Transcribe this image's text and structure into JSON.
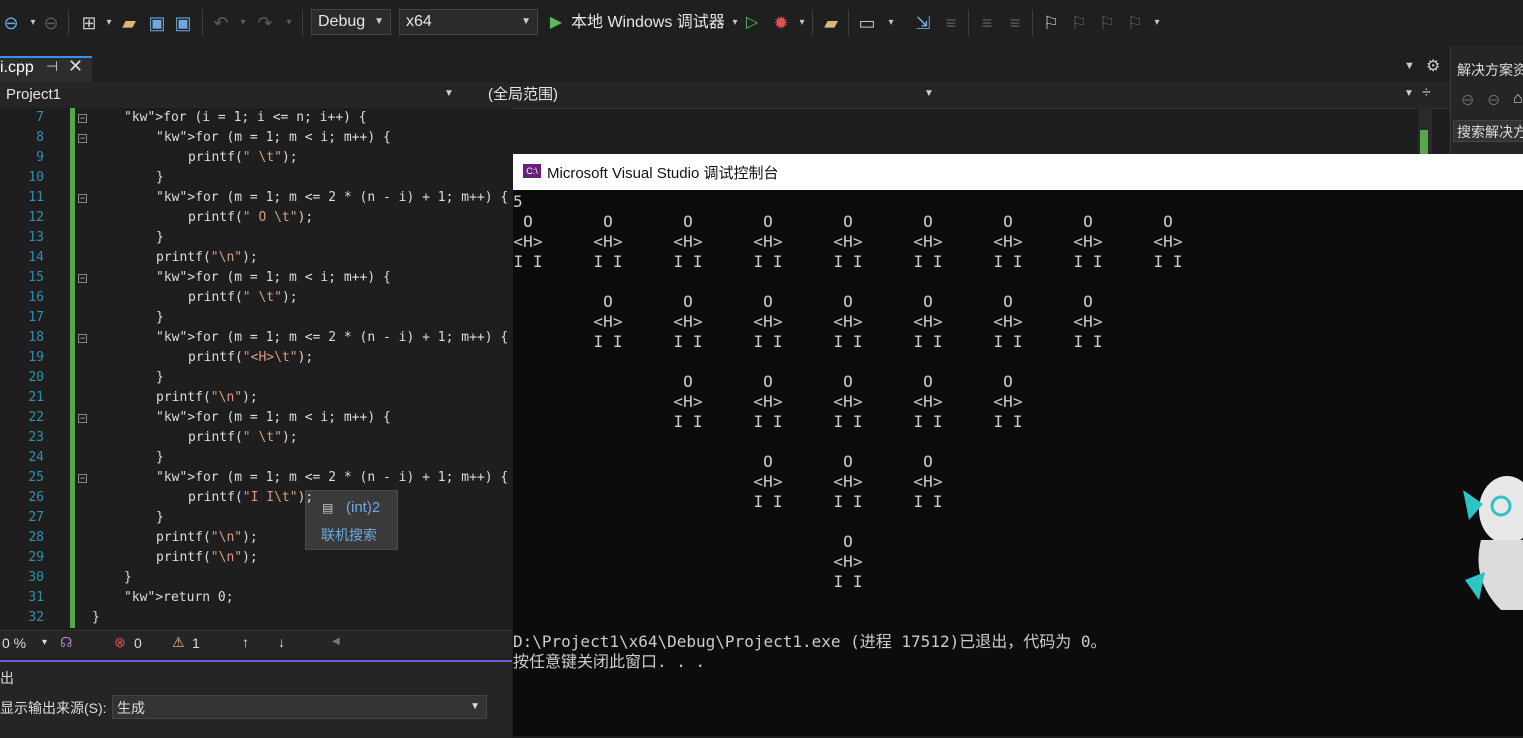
{
  "toolbar": {
    "config": "Debug",
    "platform": "x64",
    "run_label": "本地 Windows 调试器"
  },
  "tab": {
    "file": "i.cpp"
  },
  "nav": {
    "project": "Project1",
    "scope": "(全局范围)"
  },
  "solution_panel": {
    "title": "解决方案资",
    "search": "搜索解决方"
  },
  "editor": {
    "lines": [
      {
        "n": "7",
        "code": "for (i = 1; i <= n; i++) {"
      },
      {
        "n": "8",
        "code": "for (m = 1; m < i; m++) {"
      },
      {
        "n": "9",
        "code": "printf(\" \\t\");"
      },
      {
        "n": "10",
        "code": "}"
      },
      {
        "n": "11",
        "code": "for (m = 1; m <= 2 * (n - i) + 1; m++) {"
      },
      {
        "n": "12",
        "code": "printf(\" O \\t\");"
      },
      {
        "n": "13",
        "code": "}"
      },
      {
        "n": "14",
        "code": "printf(\"\\n\");"
      },
      {
        "n": "15",
        "code": "for (m = 1; m < i; m++) {"
      },
      {
        "n": "16",
        "code": "printf(\" \\t\");"
      },
      {
        "n": "17",
        "code": "}"
      },
      {
        "n": "18",
        "code": "for (m = 1; m <= 2 * (n - i) + 1; m++) {"
      },
      {
        "n": "19",
        "code": "printf(\"<H>\\t\");"
      },
      {
        "n": "20",
        "code": "}"
      },
      {
        "n": "21",
        "code": "printf(\"\\n\");"
      },
      {
        "n": "22",
        "code": "for (m = 1; m < i; m++) {"
      },
      {
        "n": "23",
        "code": "printf(\" \\t\");"
      },
      {
        "n": "24",
        "code": "}"
      },
      {
        "n": "25",
        "code": "for (m = 1; m <= 2 * (n - i) + 1; m++) {"
      },
      {
        "n": "26",
        "code": "printf(\"I I\\t\");"
      },
      {
        "n": "27",
        "code": "}"
      },
      {
        "n": "28",
        "code": "printf(\"\\n\");"
      },
      {
        "n": "29",
        "code": "printf(\"\\n\");"
      },
      {
        "n": "30",
        "code": "}"
      },
      {
        "n": "31",
        "code": "return 0;"
      },
      {
        "n": "32",
        "code": "}"
      }
    ]
  },
  "tooltip": {
    "value": "(int)2",
    "link": "联机搜索"
  },
  "status": {
    "zoom": "0 %",
    "errors": "0",
    "warnings": "1"
  },
  "output": {
    "title": "出",
    "source_label": "显示输出来源(S):",
    "source_value": "生成"
  },
  "console": {
    "title": "Microsoft Visual Studio 调试控制台",
    "input": "5",
    "row_chars": [
      "O",
      "<H>",
      "I I"
    ],
    "rows": [
      9,
      7,
      5,
      3,
      1
    ],
    "exit_line": "D:\\Project1\\x64\\Debug\\Project1.exe (进程 17512)已退出，代码为 0。",
    "close_line": "按任意键关闭此窗口. . ."
  },
  "colors": {
    "accent": "#3e8eed",
    "changebar": "#57a64a",
    "line_numbers": "#2b91af"
  }
}
